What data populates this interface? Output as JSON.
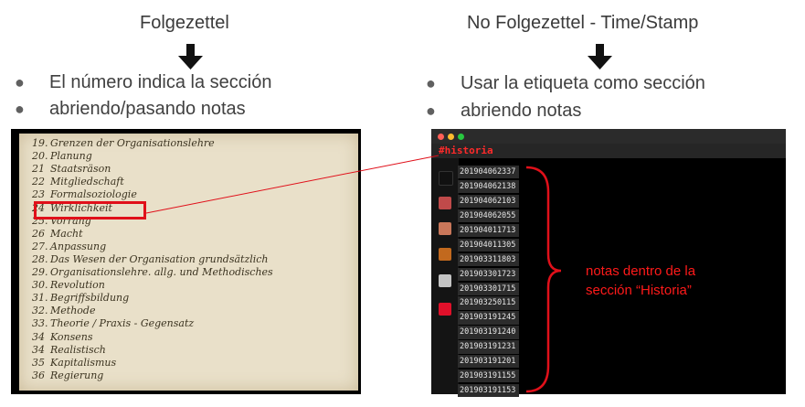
{
  "left": {
    "title": "Folgezettel",
    "bullets": [
      "El número indica la sección",
      "abriendo/pasando notas"
    ],
    "card_lines": [
      {
        "num": "19.",
        "text": "Grenzen der Organisationslehre"
      },
      {
        "num": "20.",
        "text": "Planung"
      },
      {
        "num": "21",
        "text": "Staatsräson"
      },
      {
        "num": "22",
        "text": "Mitgliedschaft"
      },
      {
        "num": "23",
        "text": "Formalsoziologie"
      },
      {
        "num": "24",
        "text": "Wirklichkeit"
      },
      {
        "num": "25.",
        "text": "Vorrang"
      },
      {
        "num": "26",
        "text": "Macht"
      },
      {
        "num": "27.",
        "text": "Anpassung"
      },
      {
        "num": "28.",
        "text": "Das Wesen der Organisation grundsätzlich"
      },
      {
        "num": "29.",
        "text": "Organisationslehre. allg. und Methodisches"
      },
      {
        "num": "30.",
        "text": "Revolution"
      },
      {
        "num": "31.",
        "text": "Begriffsbildung"
      },
      {
        "num": "32.",
        "text": "Methode"
      },
      {
        "num": "33.",
        "text": "Theorie / Praxis - Gegensatz"
      },
      {
        "num": "34",
        "text": "Konsens"
      },
      {
        "num": "34",
        "text": "Realistisch"
      },
      {
        "num": "35",
        "text": "Kapitalismus"
      },
      {
        "num": "36",
        "text": "Regierung"
      }
    ]
  },
  "right": {
    "title": "No Folgezettel - Time/Stamp",
    "bullets": [
      "Usar la etiqueta como sección",
      "abriendo notas"
    ],
    "tag": "#historia",
    "notes": [
      "201904062337",
      "201904062138",
      "201904062103",
      "201904062055",
      "201904011713",
      "201904011305",
      "201903311803",
      "201903301723",
      "201903301715",
      "201903250115",
      "201903191245",
      "201903191240",
      "201903191231",
      "201903191201",
      "201903191155",
      "201903191153"
    ],
    "swatch_colors": [
      "#111111",
      "#c04a4a",
      "#c9775a",
      "#c2691e",
      "#c4c4c4",
      "#e0102a"
    ],
    "annotation": [
      "notas dentro de la",
      "sección “Historia”"
    ]
  },
  "colors": {
    "accent_red": "#e0101a",
    "traffic": [
      "#ff5f57",
      "#febc2e",
      "#28c840"
    ]
  }
}
